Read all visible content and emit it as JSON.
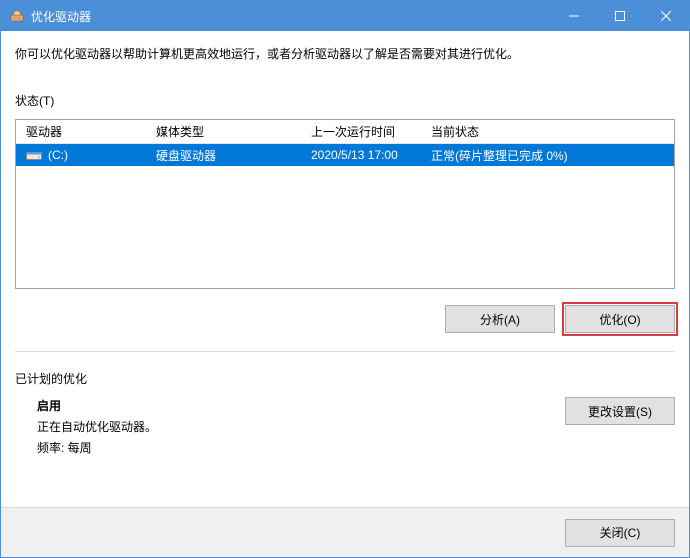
{
  "window": {
    "title": "优化驱动器"
  },
  "description": "你可以优化驱动器以帮助计算机更高效地运行，或者分析驱动器以了解是否需要对其进行优化。",
  "status_label": "状态(T)",
  "table": {
    "headers": {
      "drive": "驱动器",
      "media": "媒体类型",
      "last": "上一次运行时间",
      "state": "当前状态"
    },
    "rows": [
      {
        "drive": "(C:)",
        "media": "硬盘驱动器",
        "last": "2020/5/13 17:00",
        "state": "正常(碎片整理已完成 0%)"
      }
    ]
  },
  "buttons": {
    "analyze": "分析(A)",
    "optimize": "优化(O)",
    "change": "更改设置(S)",
    "close": "关闭(C)"
  },
  "schedule": {
    "title": "已计划的优化",
    "on_label": "启用",
    "auto_line": "正在自动优化驱动器。",
    "freq_line": "频率: 每周"
  }
}
